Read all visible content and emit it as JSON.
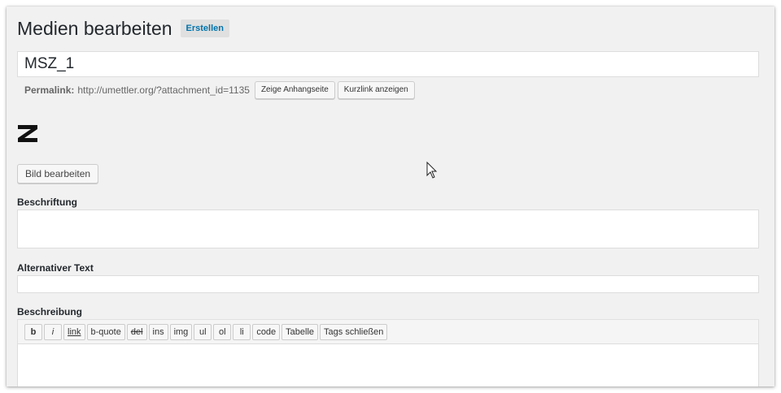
{
  "header": {
    "title": "Medien bearbeiten",
    "add_new_label": "Erstellen"
  },
  "title_field": {
    "value": "MSZ_1"
  },
  "permalink": {
    "label": "Permalink:",
    "url": "http://umettler.org/?attachment_id=1135",
    "view_button": "Zeige Anhangseite",
    "shortlink_button": "Kurzlink anzeigen"
  },
  "image": {
    "edit_button": "Bild bearbeiten"
  },
  "caption": {
    "label": "Beschriftung"
  },
  "alt_text": {
    "label": "Alternativer Text"
  },
  "description": {
    "label": "Beschreibung",
    "toolbar": [
      "b",
      "i",
      "link",
      "b-quote",
      "del",
      "ins",
      "img",
      "ul",
      "ol",
      "li",
      "code",
      "Tabelle",
      "Tags schließen"
    ]
  }
}
